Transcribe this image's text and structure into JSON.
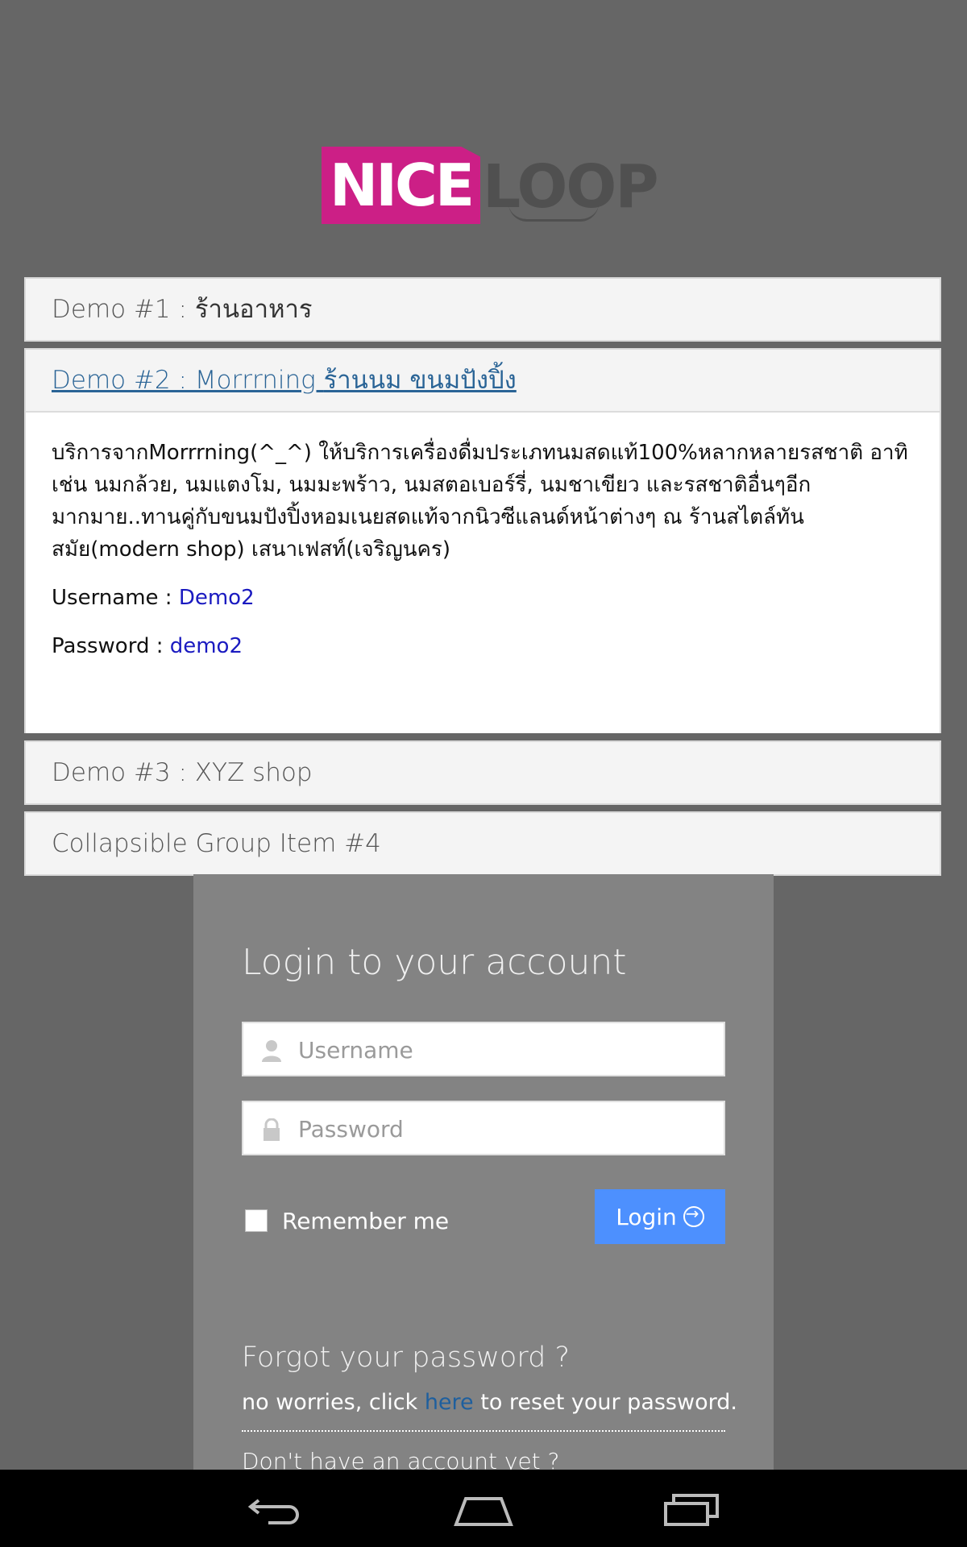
{
  "logo": {
    "nice": "NICE",
    "loop": "LOOP"
  },
  "accordion": [
    {
      "prefix": "Demo #1 : ",
      "thai": "ร้านอาหาร"
    },
    {
      "prefix": "Demo #2 : Morrrning ",
      "thai": "ร้านนม ขนมปังปิ้ง",
      "description": "บริการจากMorrrning(^_^) ให้บริการเครื่องดื่มประเภทนมสดแท้100%หลากหลายรสชาติ อาทิเช่น นมกล้วย, นมแตงโม, นมมะพร้าว, นมสตอเบอร์รี่, นมชาเขียว และรสชาติอื่นๆอีกมากมาย..ทานคู่กับขนมปังปิ้งหอมเนยสดแท้จากนิวซีแลนด์หน้าต่างๆ ณ ร้านสไตล์ทันสมัย(modern shop) เสนาเฟสท์(เจริญนคร)",
      "username_label": "Username : ",
      "username": "Demo2",
      "password_label": "Password : ",
      "password": "demo2"
    },
    {
      "label": "Demo #3 : XYZ shop"
    },
    {
      "label": "Collapsible Group Item #4"
    }
  ],
  "login": {
    "title": "Login to your account",
    "username_placeholder": "Username",
    "password_placeholder": "Password",
    "remember_label": "Remember me",
    "login_button": "Login",
    "forgot_title": "Forgot your password ?",
    "forgot_before": "no worries, click ",
    "forgot_link": "here",
    "forgot_after": " to reset your password.",
    "no_account": "Don't have an account yet ?"
  },
  "icons": [
    "user-icon",
    "lock-icon",
    "arrow-circle-icon",
    "back-icon",
    "home-icon",
    "recents-icon"
  ]
}
